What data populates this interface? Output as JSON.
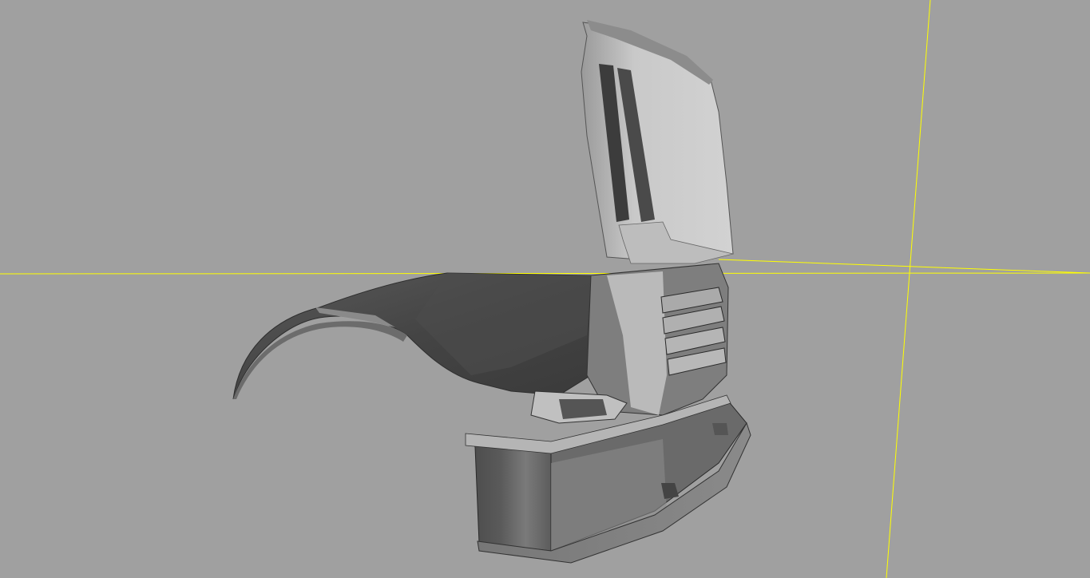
{
  "viewport": {
    "background_color": "#a0a0a0",
    "axis_color": "#ffff00",
    "model_shade_dark": "#3a3a3a",
    "model_shade_mid": "#6a6a6a",
    "model_shade_light": "#c8c8c8"
  },
  "model": {
    "icon": "car-front-bumper-mesh"
  }
}
